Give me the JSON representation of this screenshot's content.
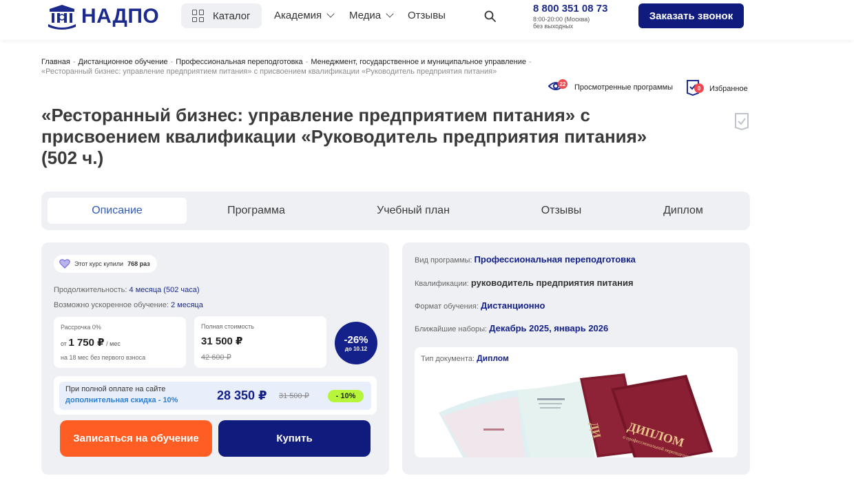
{
  "header": {
    "logo_text": "НАДПО",
    "catalog_label": "Каталог",
    "nav": [
      {
        "label": "Академия",
        "has_dropdown": true
      },
      {
        "label": "Медиа",
        "has_dropdown": true
      },
      {
        "label": "Отзывы",
        "has_dropdown": false
      }
    ],
    "phone": "8 800 351 08 73",
    "hours": "8:00-20:00 (Москва)",
    "days": "без выходных",
    "call_button": "Заказать звонок"
  },
  "breadcrumb": {
    "items": [
      "Главная",
      "Дистанционное обучение",
      "Профессиональная переподготовка",
      "Менеджмент, государственное и муниципальное управление"
    ],
    "current": "«Ресторанный бизнес: управление предприятием питания» с присвоением квалификации «Руководитель предприятия питания»"
  },
  "tools": {
    "viewed_label": "Просмотренные программы",
    "viewed_count": "22",
    "favorites_label": "Избранное",
    "favorites_count": "0"
  },
  "page_title": "«Ресторанный бизнес: управление предприятием питания» с присвоением квалификации «Руководитель предприятия питания» (502 ч.)",
  "tabs": [
    "Описание",
    "Программа",
    "Учебный план",
    "Отзывы",
    "Диплом"
  ],
  "course": {
    "bought_prefix": "Этот курс купили",
    "bought_count": "768 раз",
    "duration_label": "Продолжительность:",
    "duration_value": "4 месяца (502 часа)",
    "accelerated_label": "Возможно ускоренное обучение:",
    "accelerated_value": "2 месяца",
    "installment": {
      "label": "Рассрочка 0%",
      "prefix": "от",
      "amount": "1 750 ₽",
      "per": "/ мес",
      "note": "на 18 мес без первого взноса"
    },
    "full_price": {
      "label": "Полная стоимость",
      "amount": "31 500 ₽",
      "old": "42 600 ₽"
    },
    "discount": {
      "percent": "-26%",
      "until": "до 10.12"
    },
    "offer": {
      "line1": "При полной оплате на сайте",
      "line2": "дополнительная скидка - 10%",
      "price": "28 350 ₽",
      "old": "31 500 ₽",
      "badge": "- 10%"
    },
    "enroll_button": "Записаться на обучение",
    "buy_button": "Купить"
  },
  "info": {
    "rows": [
      {
        "label": "Вид программы:",
        "value": "Профессиональная переподготовка"
      },
      {
        "label": "Квалификации:",
        "value": "руководитель предприятия питания"
      },
      {
        "label": "Формат обучения:",
        "value": "Дистанционно"
      },
      {
        "label": "Ближайшие наборы:",
        "value": "Декабрь 2025, январь 2026"
      }
    ],
    "doc_label": "Тип документа:",
    "doc_value": "Диплом",
    "diploma_cover_text": "ДИПЛОМ",
    "diploma_cover_sub": "о профессиональной переподготовке"
  },
  "colors": {
    "brand_navy": "#0f1b7d",
    "accent_orange": "#fe5e23",
    "discount_green": "#b7f53a",
    "link_blue": "#2f5bb8"
  }
}
